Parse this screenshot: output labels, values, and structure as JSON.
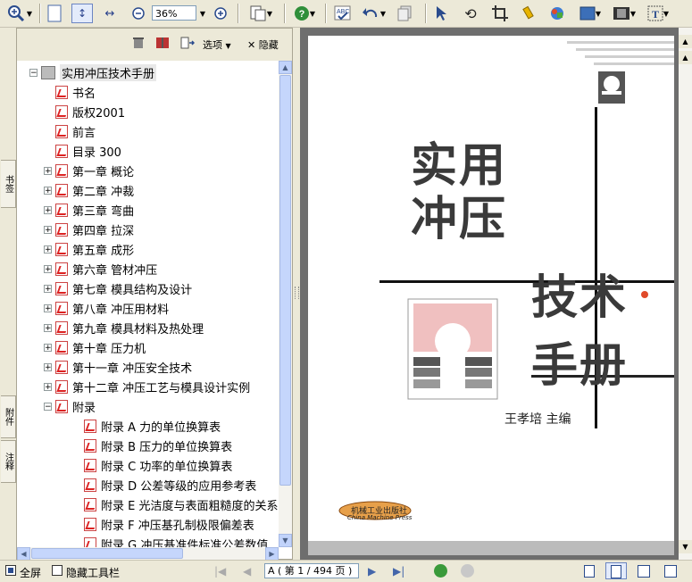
{
  "toolbar": {
    "zoom_value": "36%",
    "icons": [
      "zoom-in-icon",
      "page-fit-icon",
      "fit-height-icon",
      "fit-width-icon",
      "zoom-out-icon",
      "zoom-increase-icon",
      "page-layout-icon",
      "help-icon",
      "spellcheck-icon",
      "undo-icon",
      "copy-icon",
      "select-arrow-icon",
      "hand-tool-icon",
      "crop-icon",
      "highlighter-icon",
      "stamp-icon",
      "rectangle-icon",
      "film-icon",
      "text-select-icon"
    ]
  },
  "side_tabs": {
    "bookmarks": "书签",
    "attachments": "附件",
    "notes": "注释"
  },
  "panel_header": {
    "options_label": "选项",
    "hide_label": "隐藏"
  },
  "tree": {
    "root": "实用冲压技术手册",
    "items": [
      {
        "label": "书名",
        "level": 1,
        "expandable": false
      },
      {
        "label": "版权2001",
        "level": 1,
        "expandable": false
      },
      {
        "label": "前言",
        "level": 1,
        "expandable": false
      },
      {
        "label": "目录 300",
        "level": 1,
        "expandable": false
      },
      {
        "label": "第一章  概论",
        "level": 1,
        "expandable": true
      },
      {
        "label": "第二章  冲裁",
        "level": 1,
        "expandable": true
      },
      {
        "label": "第三章  弯曲",
        "level": 1,
        "expandable": true
      },
      {
        "label": "第四章  拉深",
        "level": 1,
        "expandable": true
      },
      {
        "label": "第五章  成形",
        "level": 1,
        "expandable": true
      },
      {
        "label": "第六章  管材冲压",
        "level": 1,
        "expandable": true
      },
      {
        "label": "第七章  模具结构及设计",
        "level": 1,
        "expandable": true
      },
      {
        "label": "第八章  冲压用材料",
        "level": 1,
        "expandable": true
      },
      {
        "label": "第九章  模具材料及热处理",
        "level": 1,
        "expandable": true
      },
      {
        "label": "第十章  压力机",
        "level": 1,
        "expandable": true
      },
      {
        "label": "第十一章  冲压安全技术",
        "level": 1,
        "expandable": true
      },
      {
        "label": "第十二章  冲压工艺与模具设计实例",
        "level": 1,
        "expandable": true
      },
      {
        "label": "附录",
        "level": 1,
        "expandable": "open"
      },
      {
        "label": "附录 A  力的单位换算表",
        "level": 2,
        "expandable": false
      },
      {
        "label": "附录 B  压力的单位换算表",
        "level": 2,
        "expandable": false
      },
      {
        "label": "附录 C  功率的单位换算表",
        "level": 2,
        "expandable": false
      },
      {
        "label": "附录 D  公差等级的应用参考表",
        "level": 2,
        "expandable": false
      },
      {
        "label": "附录 E  光洁度与表面粗糙度的关系",
        "level": 2,
        "expandable": false
      },
      {
        "label": "附录 F  冲压基孔制极限偏差表",
        "level": 2,
        "expandable": false
      },
      {
        "label": "附录 G  冲压基准件标准公差数值",
        "level": 2,
        "expandable": false
      }
    ]
  },
  "cover": {
    "title_line1": "实用",
    "title_line2": "冲压",
    "title_line3": "技术",
    "title_line4": "手册",
    "author": "王孝培  主编",
    "publisher_cn": "机械工业出版社",
    "publisher_en": "China Machine Press"
  },
  "statusbar": {
    "fullscreen_label": "全屏",
    "hide_toolbar_label": "隐藏工具栏",
    "page_indicator": "A ( 第 1 / 494 页 )"
  }
}
